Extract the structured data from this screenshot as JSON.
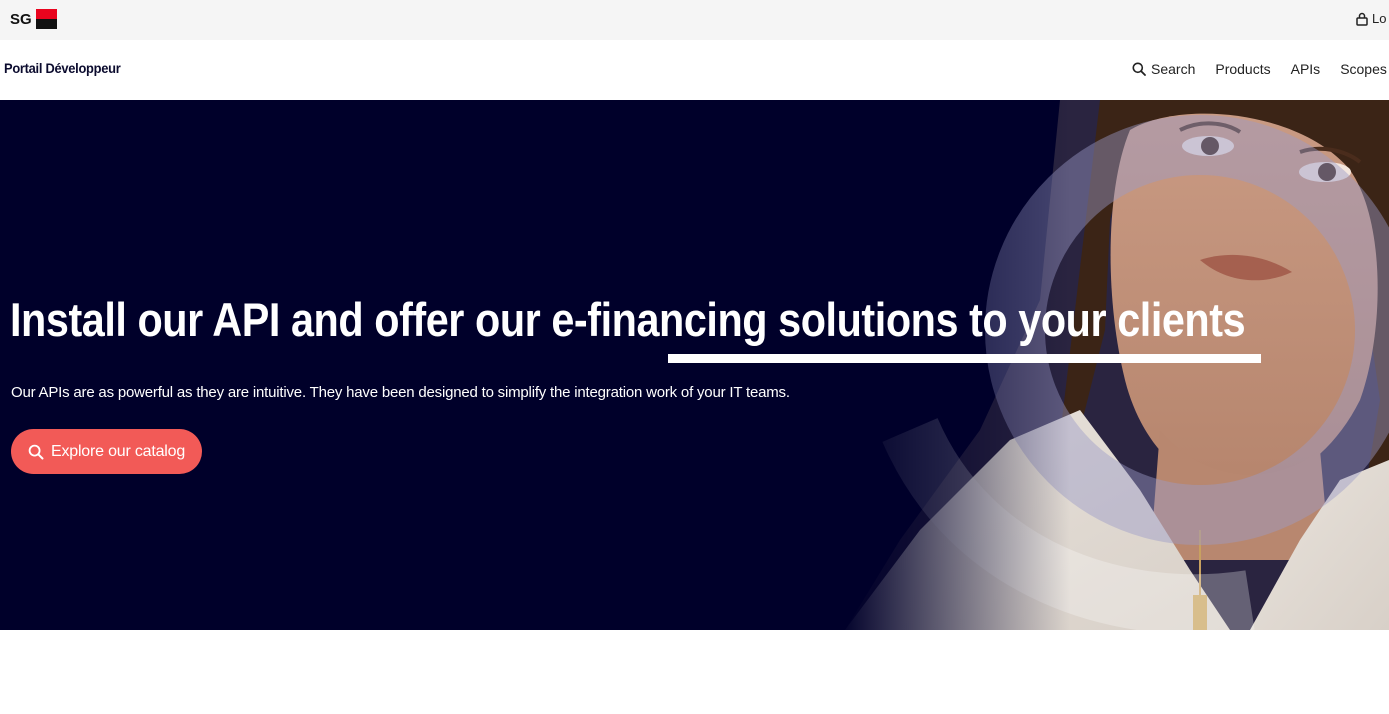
{
  "topbar": {
    "brand": "SG",
    "login_label": "Lo"
  },
  "navbar": {
    "portal_title": "Portail Développeur",
    "items": [
      {
        "label": "Search",
        "icon": "search-icon"
      },
      {
        "label": "Products"
      },
      {
        "label": "APIs"
      },
      {
        "label": "Scopes"
      }
    ]
  },
  "hero": {
    "headline": "Install our API and offer our e-financing solutions to your clients",
    "subtitle": "Our APIs are as powerful as they are intuitive. They have been designed to simplify the integration work of your IT teams.",
    "cta_label": "Explore our catalog",
    "cta_icon": "search-icon"
  },
  "colors": {
    "hero_background": "#00002a",
    "cta_background": "#f25a57",
    "brand_red": "#e9041e",
    "brand_black": "#111111"
  }
}
